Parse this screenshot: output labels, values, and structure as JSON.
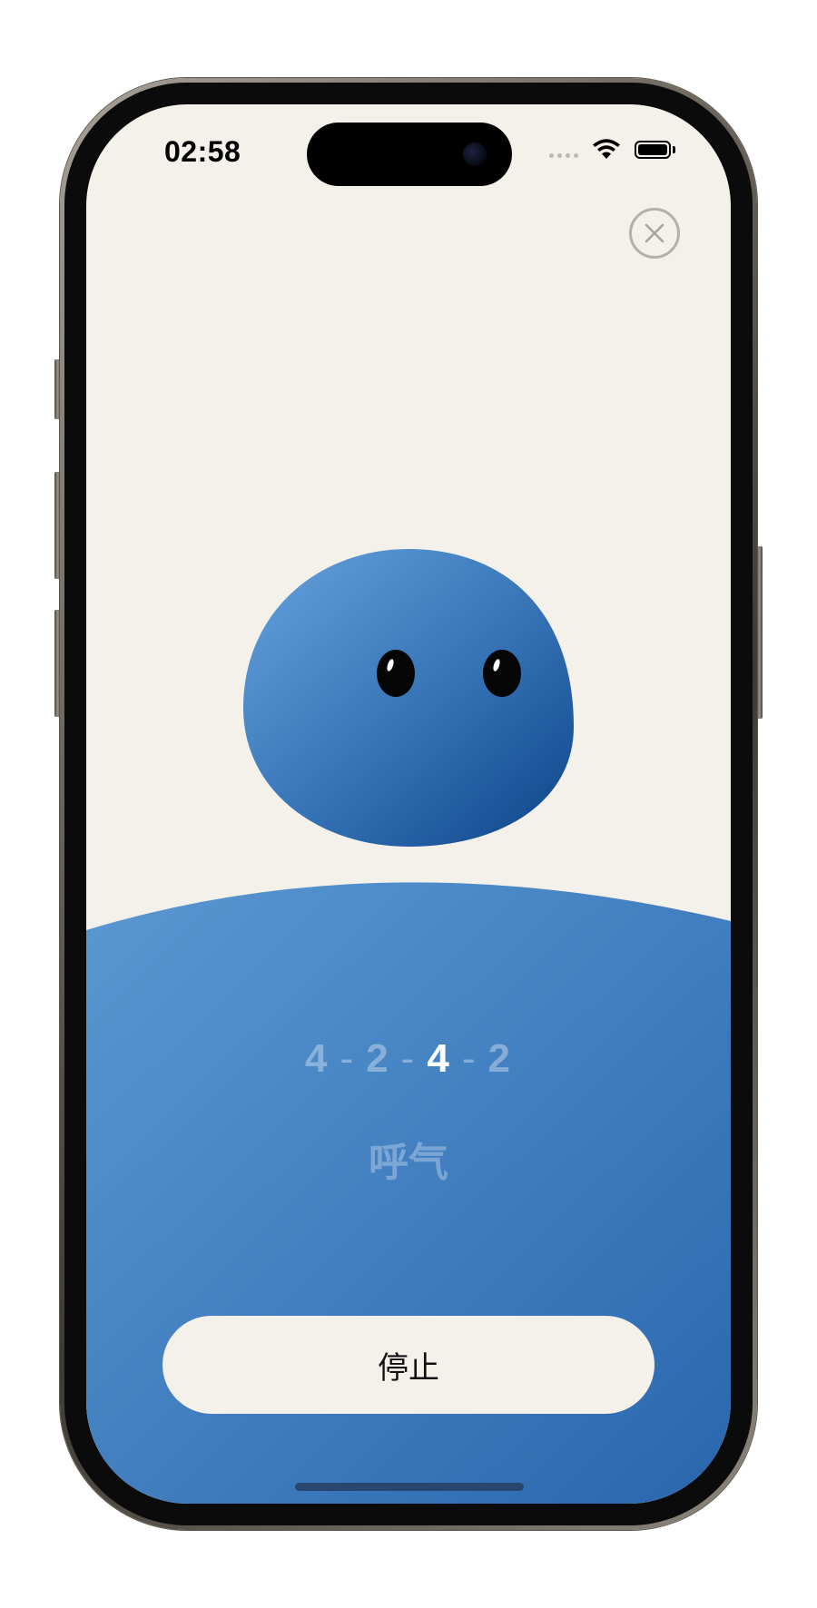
{
  "status_bar": {
    "time": "02:58",
    "icons": [
      "signal-dots-icon",
      "wifi-icon",
      "battery-icon"
    ]
  },
  "close_button": {
    "icon": "close-x-icon"
  },
  "character": {
    "icon": "blue-blob-character"
  },
  "breathing": {
    "pattern": [
      "4",
      "2",
      "4",
      "2"
    ],
    "active_index": 2,
    "separator": "-",
    "phase_label": "呼气"
  },
  "stop_button": {
    "label": "停止"
  },
  "colors": {
    "background": "#f4f1ea",
    "accent_blue": "#3f7dc0",
    "blob_light": "#5f9ad6",
    "blob_dark": "#0f4a8f"
  }
}
